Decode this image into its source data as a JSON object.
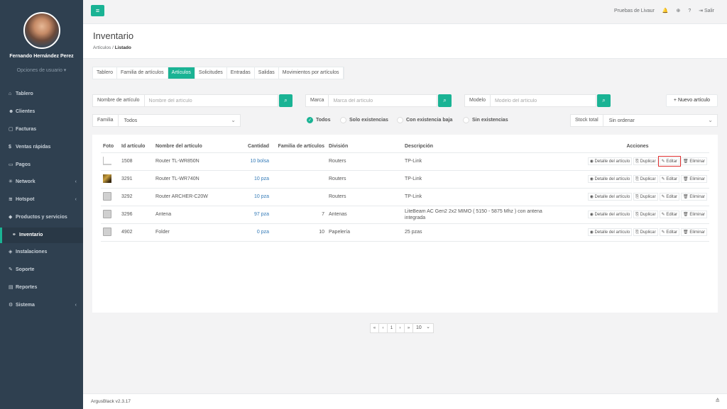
{
  "user": {
    "name": "Fernando Hernández Perez",
    "options": "Opciones de usuario ▾"
  },
  "nav": [
    {
      "icon": "⌂",
      "label": "Tablero",
      "chev": ""
    },
    {
      "icon": "☻",
      "label": "Clientes",
      "chev": ""
    },
    {
      "icon": "▢",
      "label": "Facturas",
      "chev": ""
    },
    {
      "icon": "$",
      "label": "Ventas rápidas",
      "chev": ""
    },
    {
      "icon": "▭",
      "label": "Pagos",
      "chev": ""
    },
    {
      "icon": "✳",
      "label": "Network",
      "chev": "‹"
    },
    {
      "icon": "≋",
      "label": "Hotspot",
      "chev": "‹"
    },
    {
      "icon": "◆",
      "label": "Productos y servicios",
      "chev": ""
    },
    {
      "icon": "⚭",
      "label": "Inventario",
      "chev": ""
    },
    {
      "icon": "◈",
      "label": "Instalaciones",
      "chev": ""
    },
    {
      "icon": "✎",
      "label": "Soporte",
      "chev": ""
    },
    {
      "icon": "▤",
      "label": "Reportes",
      "chev": ""
    },
    {
      "icon": "⚙",
      "label": "Sistema",
      "chev": "‹"
    }
  ],
  "topbar": {
    "menu_icon": "≡",
    "company": "Pruebas de Livaur",
    "bell": "🔔",
    "help": "?",
    "grid": "⊕",
    "logout": "⇥ Salir"
  },
  "page": {
    "title": "Inventario",
    "breadcrumb_parent": "Artículos",
    "breadcrumb_sep": "/",
    "breadcrumb_current": "Listado"
  },
  "tabs": [
    "Tablero",
    "Familia de artículos",
    "Artículos",
    "Solicitudes",
    "Entradas",
    "Salidas",
    "Movimientos por artículos"
  ],
  "filters": {
    "name_label": "Nombre de artículo",
    "name_placeholder": "Nombre del artículo",
    "brand_label": "Marca",
    "brand_placeholder": "Marca del artículo",
    "model_label": "Modelo",
    "model_placeholder": "Modelo del artículo",
    "new_button": "+ Nuevo artículo",
    "family_label": "Familia",
    "family_value": "Todos",
    "stock_label": "Stock total",
    "stock_value": "Sin ordenar",
    "radios": [
      "Todos",
      "Solo existencias",
      "Con existencia baja",
      "Sin existencias"
    ],
    "search_icon": "⌕",
    "dropdown_icon": "⌄"
  },
  "table": {
    "headers": [
      "Foto",
      "Id artículo",
      "Nombre del artículo",
      "Cantidad",
      "Familia de artículos",
      "División",
      "Descripción",
      "Acciones"
    ],
    "rows": [
      {
        "photo": "router1",
        "id": "1508",
        "name": "Router TL-WR850N",
        "qty": "10 bolsa",
        "family": "",
        "division": "Routers",
        "desc": "TP-Link"
      },
      {
        "photo": "router2",
        "id": "3291",
        "name": "Router TL-WR740N",
        "qty": "10 pza",
        "family": "",
        "division": "Routers",
        "desc": "TP-Link"
      },
      {
        "photo": "box",
        "id": "3292",
        "name": "Router ARCHER-C20W",
        "qty": "10 pza",
        "family": "",
        "division": "Routers",
        "desc": "TP-Link"
      },
      {
        "photo": "box",
        "id": "3296",
        "name": "Antena",
        "qty": "97 pza",
        "family": "7",
        "division": "Antenas",
        "desc": "LiteBeam AC Gen2 2x2 MIMO ( 5150 - 5875 Mhz ) con antena integrada"
      },
      {
        "photo": "box",
        "id": "4902",
        "name": "Folder",
        "qty": "0 pza",
        "family": "10",
        "division": "Papelería",
        "desc": "25 pzas"
      }
    ],
    "actions": [
      "◉ Detalle del artículo",
      "⎘ Duplicar",
      "✎ Editar",
      "🗑 Eliminar"
    ]
  },
  "pagination": {
    "buttons": [
      "«",
      "‹",
      "1",
      "›",
      "»"
    ],
    "page_size": "10"
  },
  "footer": {
    "version": "ArgusBlack v2.3.17",
    "icon": "≙"
  }
}
